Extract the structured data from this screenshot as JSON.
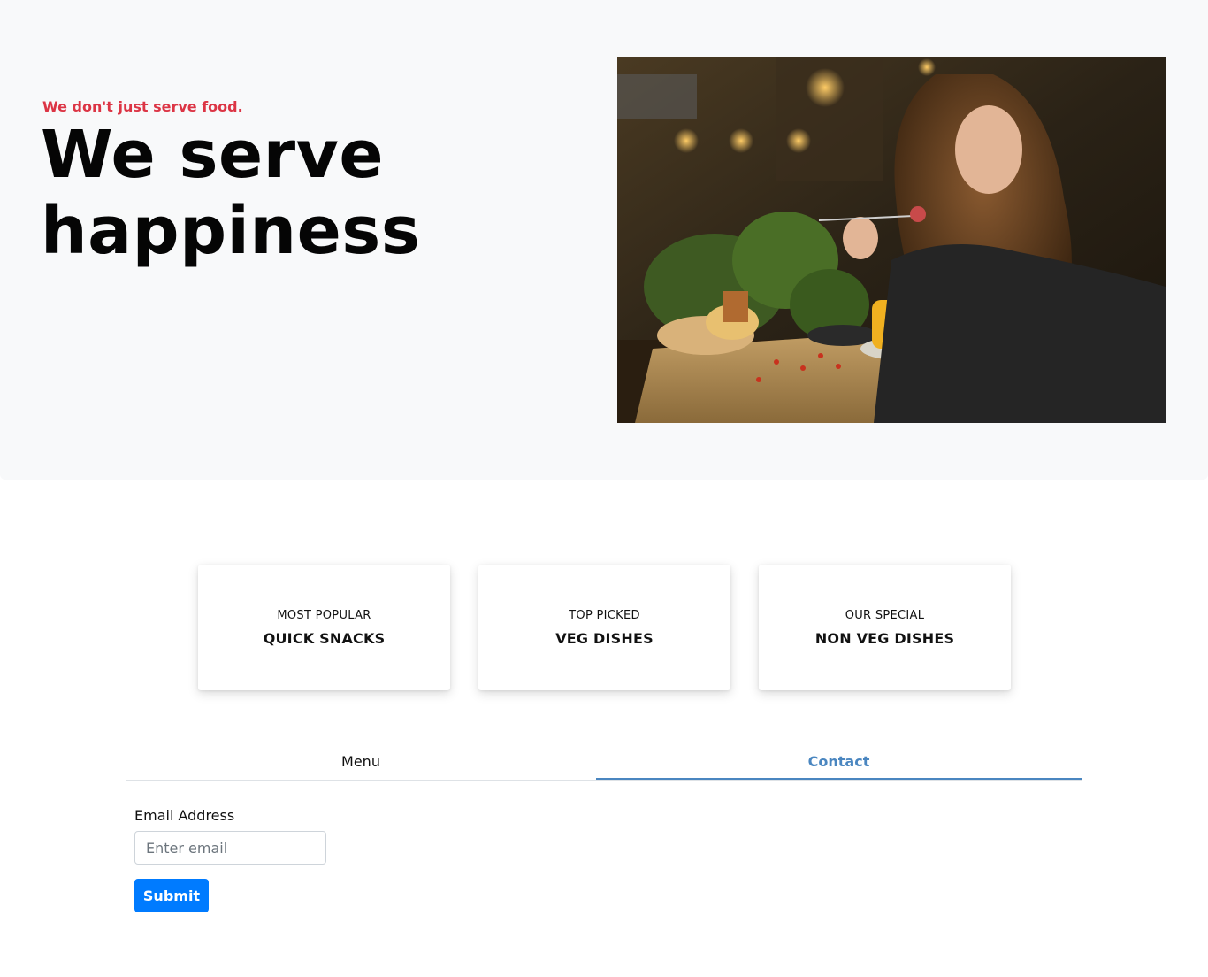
{
  "hero": {
    "tagline": "We don't just serve food.",
    "title": "We serve happiness"
  },
  "cards": [
    {
      "kicker": "MOST POPULAR",
      "title": "QUICK SNACKS"
    },
    {
      "kicker": "TOP PICKED",
      "title": "VEG DISHES"
    },
    {
      "kicker": "OUR SPECIAL",
      "title": "NON VEG DISHES"
    }
  ],
  "tabs": [
    {
      "label": "Menu",
      "active": false
    },
    {
      "label": "Contact",
      "active": true
    }
  ],
  "form": {
    "email_label": "Email Address",
    "email_placeholder": "Enter email",
    "email_value": "",
    "submit_label": "Submit"
  },
  "colors": {
    "tagline": "#dc3545",
    "active_tab": "#4a86c0",
    "submit": "#007bff",
    "hero_bg": "#f8f9fa"
  }
}
